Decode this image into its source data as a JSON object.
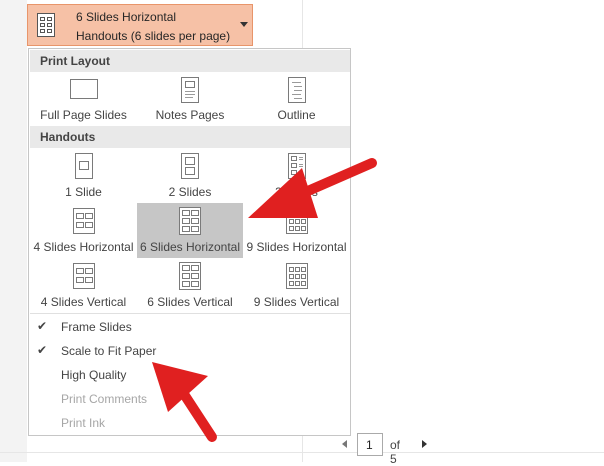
{
  "selector": {
    "line1": "6 Slides Horizontal",
    "line2": "Handouts (6 slides per page)",
    "icon": "six-slides-horizontal-icon"
  },
  "print_layout": {
    "header": "Print Layout",
    "items": [
      {
        "label": "Full Page Slides",
        "icon": "full-page-slide-icon"
      },
      {
        "label": "Notes Pages",
        "icon": "notes-page-icon"
      },
      {
        "label": "Outline",
        "icon": "outline-icon"
      }
    ]
  },
  "handouts": {
    "header": "Handouts",
    "items": [
      {
        "label": "1 Slide"
      },
      {
        "label": "2 Slides"
      },
      {
        "label": "3 Slides"
      },
      {
        "label": "4 Slides Horizontal"
      },
      {
        "label": "6 Slides Horizontal"
      },
      {
        "label": "9 Slides Horizontal"
      },
      {
        "label": "4 Slides Vertical"
      },
      {
        "label": "6 Slides Vertical"
      },
      {
        "label": "9 Slides Vertical"
      }
    ],
    "selected": "6 Slides Horizontal"
  },
  "options": [
    {
      "label": "Frame Slides",
      "checked": true,
      "enabled": true
    },
    {
      "label": "Scale to Fit Paper",
      "checked": true,
      "enabled": true
    },
    {
      "label": "High Quality",
      "checked": false,
      "enabled": true
    },
    {
      "label": "Print Comments",
      "checked": false,
      "enabled": false
    },
    {
      "label": "Print Ink",
      "checked": false,
      "enabled": false
    }
  ],
  "pager": {
    "current": "1",
    "total_label": "of 5"
  },
  "colors": {
    "selector_bg": "#f6c1a6",
    "selector_border": "#e8956a",
    "selected_item_bg": "#c6c6c6",
    "annotation_arrow": "#e02020"
  }
}
